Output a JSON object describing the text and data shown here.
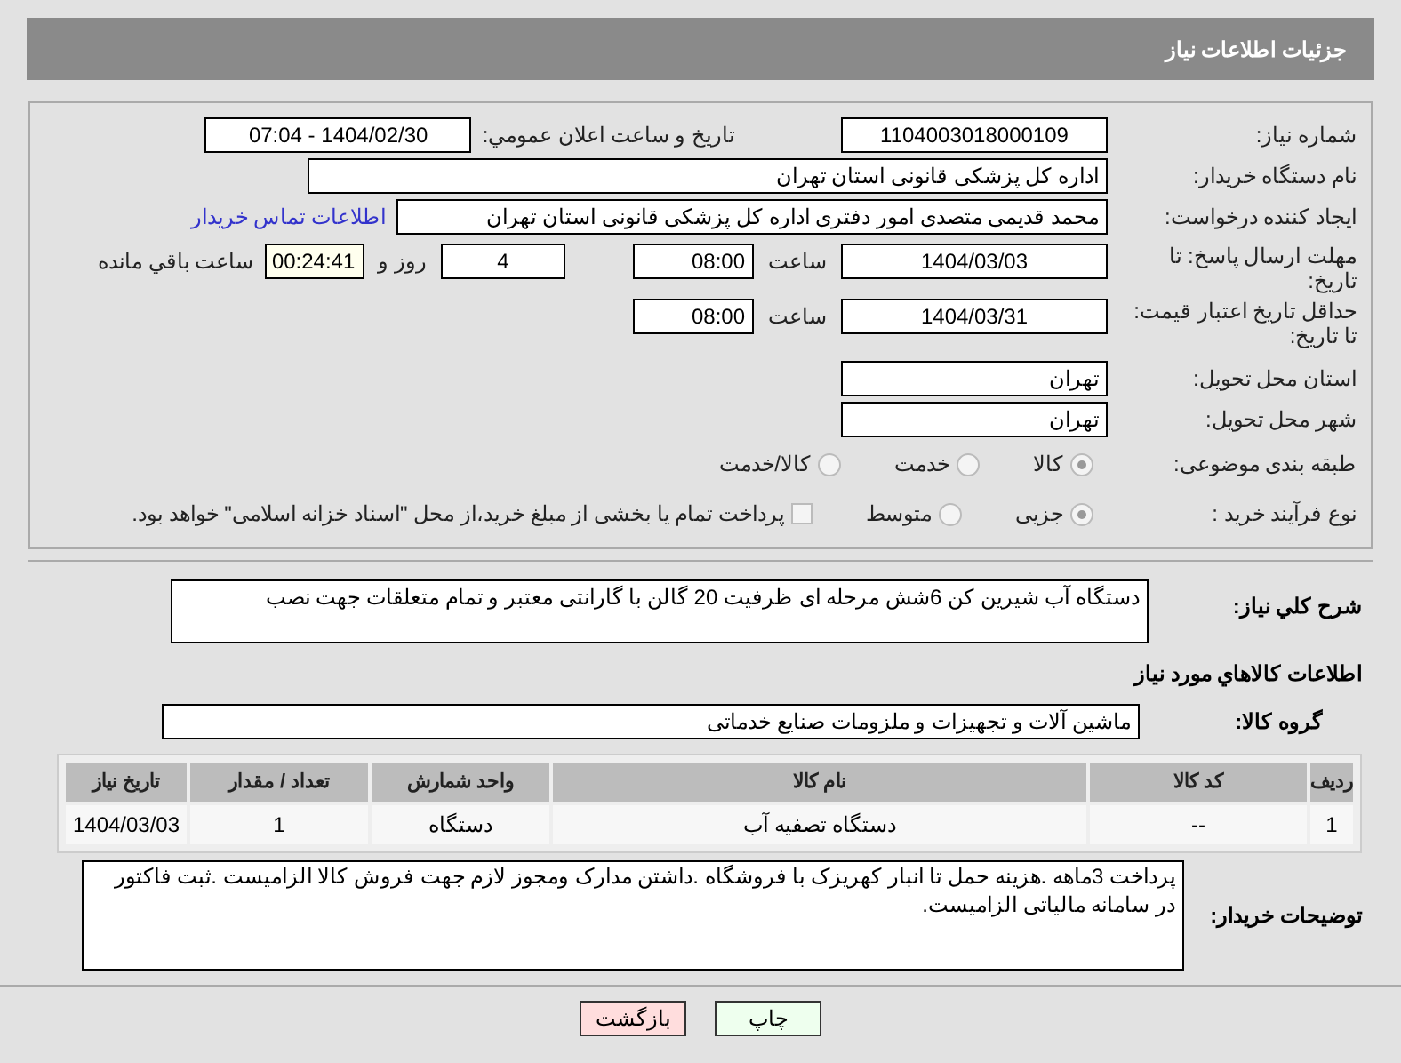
{
  "header": {
    "title": "جزئیات اطلاعات نیاز"
  },
  "need_number": {
    "label": "شماره نیاز:",
    "value": "1104003018000109"
  },
  "announce": {
    "label": "تاریخ و ساعت اعلان عمومي:",
    "value": "1404/02/30 - 07:04"
  },
  "buyer": {
    "label": "نام دستگاه خریدار:",
    "value": "اداره کل پزشکی قانونی استان تهران"
  },
  "creator": {
    "label": "ایجاد کننده درخواست:",
    "value": "محمد قدیمی متصدی امور دفتری اداره کل پزشکی قانونی استان تهران",
    "link": "اطلاعات تماس خریدار"
  },
  "deadline": {
    "label": "مهلت ارسال پاسخ: تا تاریخ:",
    "date": "1404/03/03",
    "time_label": "ساعت",
    "time": "08:00",
    "days": "4",
    "days_label": "روز و",
    "remaining": "00:24:41",
    "remaining_label": "ساعت باقي مانده"
  },
  "validity": {
    "label": "حداقل تاریخ اعتبار قیمت: تا تاریخ:",
    "date": "1404/03/31",
    "time_label": "ساعت",
    "time": "08:00"
  },
  "province": {
    "label": "استان محل تحویل:",
    "value": "تهران"
  },
  "city": {
    "label": "شهر محل تحویل:",
    "value": "تهران"
  },
  "category": {
    "label": "طبقه بندی موضوعی:",
    "options": [
      {
        "label": "کالا",
        "selected": true
      },
      {
        "label": "خدمت",
        "selected": false
      },
      {
        "label": "کالا/خدمت",
        "selected": false
      }
    ]
  },
  "process": {
    "label": "نوع فرآیند خرید :",
    "options": [
      {
        "label": "جزیی",
        "selected": true
      },
      {
        "label": "متوسط",
        "selected": false
      }
    ],
    "treasury": {
      "label": "پرداخت تمام یا بخشی از مبلغ خرید،از محل \"اسناد خزانه اسلامی\" خواهد بود.",
      "checked": false
    }
  },
  "description": {
    "label": "شرح کلي نیاز:",
    "value": "دستگاه آب شیرین کن 6شش مرحله ای  ظرفیت 20 گالن  با گارانتی معتبر و تمام متعلقات جهت نصب"
  },
  "goods_title": "اطلاعات کالاهاي مورد نیاز",
  "goods_group": {
    "label": "گروه کالا:",
    "value": "ماشین آلات و تجهیزات و ملزومات صنایع خدماتی"
  },
  "table": {
    "columns": [
      "ردیف",
      "کد کالا",
      "نام کالا",
      "واحد شمارش",
      "تعداد / مقدار",
      "تاریخ نیاز"
    ],
    "rows": [
      [
        "1",
        "--",
        "دستگاه تصفیه آب",
        "دستگاه",
        "1",
        "1404/03/03"
      ]
    ]
  },
  "buyer_notes": {
    "label": "توضیحات خریدار:",
    "value": "پرداخت 3ماهه .هزینه حمل تا انبار کهریزک با فروشگاه .داشتن مدارک ومجوز لازم جهت فروش کالا الزامیست .ثبت فاکتور در سامانه مالیاتی الزامیست."
  },
  "buttons": [
    {
      "label": "چاپ",
      "kind": "print"
    },
    {
      "label": "بازگشت",
      "kind": "back"
    }
  ]
}
